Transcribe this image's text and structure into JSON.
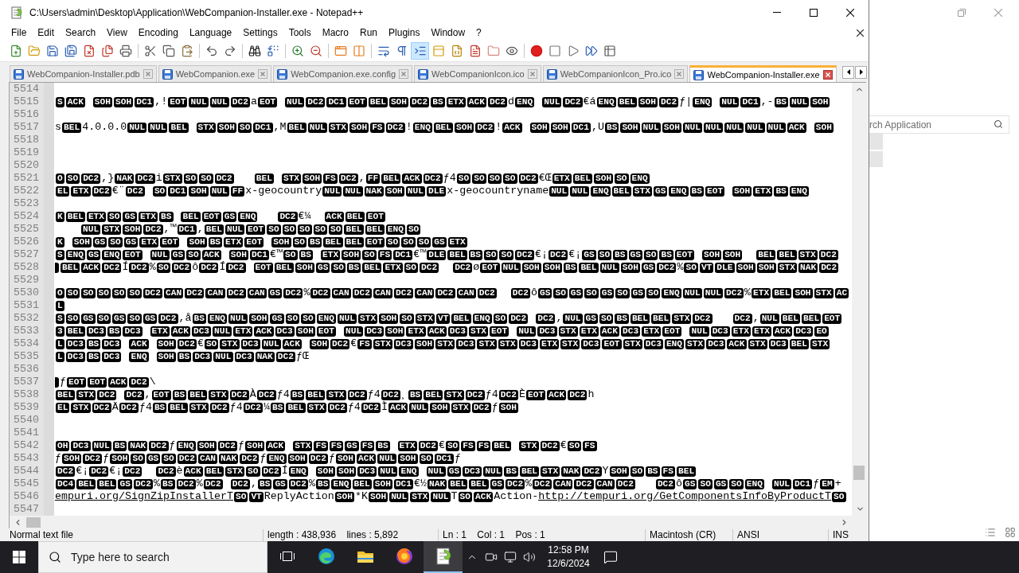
{
  "window": {
    "title": "C:\\Users\\admin\\Desktop\\Application\\WebCompanion-Installer.exe - Notepad++"
  },
  "menu": [
    "File",
    "Edit",
    "Search",
    "View",
    "Encoding",
    "Language",
    "Settings",
    "Tools",
    "Macro",
    "Run",
    "Plugins",
    "Window",
    "?"
  ],
  "toolbar": {
    "groups": [
      [
        {
          "pressed": false
        },
        {
          "pressed": false
        },
        {
          "pressed": false
        },
        {
          "pressed": false
        },
        {
          "pressed": false
        },
        {
          "pressed": false
        },
        {
          "pressed": false
        }
      ],
      [
        {
          "pressed": false
        },
        {
          "pressed": false
        },
        {
          "pressed": false
        }
      ],
      [
        {
          "pressed": false
        },
        {
          "pressed": false
        }
      ],
      [
        {
          "pressed": false
        },
        {
          "pressed": false
        }
      ],
      [
        {
          "pressed": false
        },
        {
          "pressed": false
        }
      ],
      [
        {
          "pressed": false
        },
        {
          "pressed": false
        }
      ],
      [
        {
          "pressed": false
        },
        {
          "pressed": false
        },
        {
          "pressed": true
        },
        {
          "pressed": false
        },
        {
          "pressed": false
        },
        {
          "pressed": false
        },
        {
          "pressed": false
        },
        {
          "pressed": false
        }
      ],
      [
        {
          "pressed": false
        },
        {
          "pressed": false
        },
        {
          "pressed": false
        },
        {
          "pressed": false
        },
        {
          "pressed": false
        }
      ]
    ]
  },
  "tabs": [
    {
      "label": "WebCompanion-Installer.pdb",
      "selected": false
    },
    {
      "label": "WebCompanion.exe",
      "selected": false
    },
    {
      "label": "WebCompanion.exe.config",
      "selected": false
    },
    {
      "label": "WebCompanionIcon.ico",
      "selected": false
    },
    {
      "label": "WebCompanionIcon_Pro.ico",
      "selected": false
    },
    {
      "label": "WebCompanion-Installer.exe",
      "selected": true
    }
  ],
  "editor": {
    "lines": [
      {
        "number": "5514"
      },
      {
        "number": "5515",
        "segments": [
          {
            "kind": "ctrl",
            "codes": [
              "S",
              "ACK"
            ]
          },
          {
            "kind": "gap"
          },
          {
            "kind": "ctrl",
            "codes": [
              "SOH",
              "SOH",
              "DC1"
            ]
          },
          {
            "kind": "text",
            "text": ",!"
          },
          {
            "kind": "ctrl",
            "codes": [
              "EOT",
              "NUL",
              "NUL",
              "DC2"
            ]
          },
          {
            "kind": "text",
            "text": "a"
          },
          {
            "kind": "ctrl",
            "codes": [
              "EOT"
            ]
          },
          {
            "kind": "gap"
          },
          {
            "kind": "ctrl",
            "codes": [
              "NUL",
              "DC2",
              "DC1",
              "EOT",
              "BEL",
              "SOH",
              "DC2",
              "BS",
              "ETX",
              "ACK",
              "DC2"
            ]
          },
          {
            "kind": "text",
            "text": "d"
          },
          {
            "kind": "ctrl",
            "codes": [
              "ENQ"
            ]
          },
          {
            "kind": "gap"
          },
          {
            "kind": "ctrl",
            "codes": [
              "NUL",
              "DC2"
            ]
          },
          {
            "kind": "text",
            "text": "€á"
          },
          {
            "kind": "ctrl",
            "codes": [
              "ENQ",
              "BEL",
              "SOH",
              "DC2"
            ]
          },
          {
            "kind": "text",
            "text": "ƒ|"
          },
          {
            "kind": "ctrl",
            "codes": [
              "ENQ"
            ]
          },
          {
            "kind": "gap"
          },
          {
            "kind": "ctrl",
            "codes": [
              "NUL",
              "DC1"
            ]
          },
          {
            "kind": "text",
            "text": ",-"
          },
          {
            "kind": "ctrl",
            "codes": [
              "BS",
              "NUL",
              "SOH"
            ]
          }
        ]
      },
      {
        "number": "5516"
      },
      {
        "number": "5517",
        "segments": [
          {
            "kind": "text",
            "text": "s"
          },
          {
            "kind": "ctrl",
            "codes": [
              "BEL"
            ]
          },
          {
            "kind": "text",
            "text": "4.0.0.0"
          },
          {
            "kind": "ctrl",
            "codes": [
              "NUL",
              "NUL",
              "BEL"
            ]
          },
          {
            "kind": "gap"
          },
          {
            "kind": "ctrl",
            "codes": [
              "STX",
              "SOH",
              "SO",
              "DC1"
            ]
          },
          {
            "kind": "text",
            "text": ",M"
          },
          {
            "kind": "ctrl",
            "codes": [
              "BEL",
              "NUL",
              "STX",
              "SOH",
              "FS",
              "DC2"
            ]
          },
          {
            "kind": "text",
            "text": "!"
          },
          {
            "kind": "ctrl",
            "codes": [
              "ENQ",
              "BEL",
              "SOH",
              "DC2"
            ]
          },
          {
            "kind": "text",
            "text": "!"
          },
          {
            "kind": "ctrl",
            "codes": [
              "ACK"
            ]
          },
          {
            "kind": "gap"
          },
          {
            "kind": "ctrl",
            "codes": [
              "SOH",
              "SOH",
              "DC1"
            ]
          },
          {
            "kind": "text",
            "text": ",U"
          },
          {
            "kind": "ctrl",
            "codes": [
              "BS",
              "SOH",
              "NUL",
              "SOH",
              "NUL",
              "NUL",
              "NUL",
              "NUL",
              "NUL",
              "ACK"
            ]
          },
          {
            "kind": "gap"
          },
          {
            "kind": "ctrl",
            "codes": [
              "SOH"
            ]
          }
        ]
      },
      {
        "number": "5518"
      },
      {
        "number": "5519"
      },
      {
        "number": "5520"
      },
      {
        "number": "5521",
        "segments": [
          {
            "kind": "ctrl",
            "codes": [
              "O",
              "SO",
              "DC2"
            ]
          },
          {
            "kind": "text",
            "text": ",}"
          },
          {
            "kind": "ctrl",
            "codes": [
              "NAK",
              "DC2"
            ]
          },
          {
            "kind": "text",
            "text": "i"
          },
          {
            "kind": "ctrl",
            "codes": [
              "STX",
              "SO",
              "SO",
              "DC2"
            ]
          },
          {
            "kind": "gap3"
          },
          {
            "kind": "ctrl",
            "codes": [
              "BEL"
            ]
          },
          {
            "kind": "gap"
          },
          {
            "kind": "ctrl",
            "codes": [
              "STX",
              "SOH",
              "FS",
              "DC2"
            ]
          },
          {
            "kind": "text",
            "text": ","
          },
          {
            "kind": "ctrl",
            "codes": [
              "FF",
              "BEL",
              "ACK",
              "DC2"
            ]
          },
          {
            "kind": "text",
            "text": "ƒ4"
          },
          {
            "kind": "ctrl",
            "codes": [
              "SO",
              "SO",
              "SO",
              "SO",
              "DC2"
            ]
          },
          {
            "kind": "text",
            "text": "€Œ"
          },
          {
            "kind": "ctrl",
            "codes": [
              "ETX",
              "BEL",
              "SOH",
              "SO",
              "ENQ"
            ]
          }
        ]
      },
      {
        "number": "5522",
        "segments": [
          {
            "kind": "ctrl",
            "codes": [
              "EL",
              "ETX",
              "DC2"
            ]
          },
          {
            "kind": "text",
            "text": "€¨"
          },
          {
            "kind": "ctrl",
            "codes": [
              "DC2"
            ]
          },
          {
            "kind": "gap"
          },
          {
            "kind": "ctrl",
            "codes": [
              "SO",
              "DC1",
              "SOH",
              "NUL",
              "FF"
            ]
          },
          {
            "kind": "text",
            "text": "x-geocountry"
          },
          {
            "kind": "ctrl",
            "codes": [
              "NUL",
              "NUL",
              "NAK",
              "SOH",
              "NUL",
              "DLE"
            ]
          },
          {
            "kind": "text",
            "text": "x-geocountryname"
          },
          {
            "kind": "ctrl",
            "codes": [
              "NUL",
              "NUL",
              "ENQ",
              "BEL",
              "STX",
              "GS",
              "ENQ",
              "BS",
              "EOT"
            ]
          },
          {
            "kind": "gap"
          },
          {
            "kind": "ctrl",
            "codes": [
              "SOH",
              "ETX",
              "BS",
              "ENQ"
            ]
          }
        ]
      },
      {
        "number": "5523"
      },
      {
        "number": "5524",
        "segments": [
          {
            "kind": "ctrl",
            "codes": [
              "K",
              "BEL",
              "ETX",
              "SO",
              "GS",
              "ETX",
              "BS"
            ]
          },
          {
            "kind": "gap"
          },
          {
            "kind": "ctrl",
            "codes": [
              "BEL",
              "EOT",
              "GS",
              "ENQ"
            ]
          },
          {
            "kind": "gap3"
          },
          {
            "kind": "ctrl",
            "codes": [
              "DC2"
            ]
          },
          {
            "kind": "text",
            "text": "€¼"
          },
          {
            "kind": "gap2"
          },
          {
            "kind": "ctrl",
            "codes": [
              "ACK",
              "BEL",
              "EOT"
            ]
          }
        ]
      },
      {
        "number": "5525",
        "segments": [
          {
            "kind": "gap4"
          },
          {
            "kind": "ctrl",
            "codes": [
              "NUL",
              "STX",
              "SOH",
              "DC2"
            ]
          },
          {
            "kind": "text",
            "text": ",™"
          },
          {
            "kind": "ctrl",
            "codes": [
              "DC1"
            ]
          },
          {
            "kind": "text",
            "text": ","
          },
          {
            "kind": "ctrl",
            "codes": [
              "BEL",
              "NUL",
              "EOT",
              "SO",
              "SO",
              "SO",
              "SO",
              "SO",
              "BEL",
              "BEL",
              "ENQ",
              "SO"
            ]
          }
        ]
      },
      {
        "number": "5526",
        "segments": [
          {
            "kind": "ctrl",
            "codes": [
              "K"
            ]
          },
          {
            "kind": "gap"
          },
          {
            "kind": "ctrl",
            "codes": [
              "SOH",
              "GS",
              "SO",
              "GS",
              "ETX",
              "EOT"
            ]
          },
          {
            "kind": "gap"
          },
          {
            "kind": "ctrl",
            "codes": [
              "SOH",
              "BS",
              "ETX",
              "EOT"
            ]
          },
          {
            "kind": "gap"
          },
          {
            "kind": "ctrl",
            "codes": [
              "SOH",
              "SO",
              "BS",
              "BEL",
              "BEL",
              "EOT",
              "SO",
              "SO",
              "SO",
              "GS",
              "ETX"
            ]
          }
        ]
      },
      {
        "number": "5527",
        "segments": [
          {
            "kind": "ctrl",
            "codes": [
              "S",
              "ENQ",
              "GS",
              "ENQ",
              "EOT"
            ]
          },
          {
            "kind": "gap"
          },
          {
            "kind": "ctrl",
            "codes": [
              "NUL",
              "GS",
              "SO",
              "ACK"
            ]
          },
          {
            "kind": "gap"
          },
          {
            "kind": "ctrl",
            "codes": [
              "SOH",
              "DC1"
            ]
          },
          {
            "kind": "text",
            "text": "€™"
          },
          {
            "kind": "ctrl",
            "codes": [
              "SO",
              "BS"
            ]
          },
          {
            "kind": "gap"
          },
          {
            "kind": "ctrl",
            "codes": [
              "ETX",
              "SOH",
              "SO",
              "FS",
              "DC1"
            ]
          },
          {
            "kind": "text",
            "text": "€™"
          },
          {
            "kind": "ctrl",
            "codes": [
              "DLE",
              "BEL",
              "BS",
              "SO",
              "SO",
              "DC2"
            ]
          },
          {
            "kind": "text",
            "text": "€¡"
          },
          {
            "kind": "ctrl",
            "codes": [
              "DC2"
            ]
          },
          {
            "kind": "text",
            "text": "€¡"
          },
          {
            "kind": "ctrl",
            "codes": [
              "GS",
              "SO",
              "BS",
              "GS",
              "SO",
              "BS",
              "EOT"
            ]
          },
          {
            "kind": "gap"
          },
          {
            "kind": "ctrl",
            "codes": [
              "SOH",
              "SOH"
            ]
          },
          {
            "kind": "gap2"
          },
          {
            "kind": "ctrl",
            "codes": [
              "BEL",
              "BEL",
              "STX",
              "DC2"
            ]
          }
        ]
      },
      {
        "number": "5528",
        "segments": [
          {
            "kind": "clipped"
          },
          {
            "kind": "ctrl",
            "codes": [
              "BEL",
              "ACK",
              "DC2"
            ]
          },
          {
            "kind": "text",
            "text": "Í"
          },
          {
            "kind": "ctrl",
            "codes": [
              "DC2"
            ]
          },
          {
            "kind": "text",
            "text": "%"
          },
          {
            "kind": "ctrl",
            "codes": [
              "SO",
              "DC2"
            ]
          },
          {
            "kind": "text",
            "text": "ô"
          },
          {
            "kind": "ctrl",
            "codes": [
              "DC2"
            ]
          },
          {
            "kind": "text",
            "text": "Í"
          },
          {
            "kind": "ctrl",
            "codes": [
              "DC2"
            ]
          },
          {
            "kind": "gap"
          },
          {
            "kind": "ctrl",
            "codes": [
              "EOT",
              "BEL",
              "SOH",
              "GS",
              "SO",
              "BS",
              "BEL",
              "ETX",
              "SO",
              "DC2"
            ]
          },
          {
            "kind": "gap2"
          },
          {
            "kind": "ctrl",
            "codes": [
              "DC2"
            ]
          },
          {
            "kind": "text",
            "text": "ø"
          },
          {
            "kind": "ctrl",
            "codes": [
              "EOT",
              "NUL",
              "SOH",
              "SOH",
              "BS",
              "BEL",
              "NUL",
              "SOH",
              "GS",
              "DC2"
            ]
          },
          {
            "kind": "text",
            "text": "%"
          },
          {
            "kind": "ctrl",
            "codes": [
              "SO",
              "VT",
              "DLE",
              "SOH",
              "SOH",
              "STX",
              "NAK",
              "DC2"
            ]
          }
        ]
      },
      {
        "number": "5529"
      },
      {
        "number": "5530",
        "segments": [
          {
            "kind": "ctrl",
            "codes": [
              "O",
              "SO",
              "SO",
              "SO",
              "SO",
              "SO",
              "DC2",
              "CAN",
              "DC2",
              "CAN",
              "DC2",
              "CAN",
              "GS",
              "DC2"
            ]
          },
          {
            "kind": "text",
            "text": "%"
          },
          {
            "kind": "ctrl",
            "codes": [
              "DC2",
              "CAN",
              "DC2",
              "CAN",
              "DC2",
              "CAN",
              "DC2",
              "CAN",
              "DC2"
            ]
          },
          {
            "kind": "gap2"
          },
          {
            "kind": "ctrl",
            "codes": [
              "DC2"
            ]
          },
          {
            "kind": "text",
            "text": "ô"
          },
          {
            "kind": "ctrl",
            "codes": [
              "GS",
              "SO",
              "GS",
              "SO",
              "GS",
              "SO",
              "GS",
              "SO",
              "ENQ",
              "NUL",
              "NUL",
              "DC2"
            ]
          },
          {
            "kind": "text",
            "text": "%"
          },
          {
            "kind": "ctrl",
            "codes": [
              "ETX",
              "BEL",
              "SOH",
              "STX",
              "AC"
            ]
          }
        ]
      },
      {
        "number": "5531",
        "segments": [
          {
            "kind": "ctrl",
            "codes": [
              "L"
            ]
          }
        ]
      },
      {
        "number": "5532",
        "segments": [
          {
            "kind": "ctrl",
            "codes": [
              "S",
              "SO",
              "GS",
              "SO",
              "GS",
              "SO",
              "GS",
              "DC2"
            ]
          },
          {
            "kind": "text",
            "text": ",å"
          },
          {
            "kind": "ctrl",
            "codes": [
              "BS",
              "ENQ",
              "NUL",
              "SOH",
              "GS",
              "SO",
              "SO",
              "ENQ",
              "NUL",
              "STX",
              "SOH",
              "SO",
              "STX",
              "VT",
              "BEL",
              "ENQ",
              "SO",
              "DC2"
            ]
          },
          {
            "kind": "gap"
          },
          {
            "kind": "ctrl",
            "codes": [
              "DC2"
            ]
          },
          {
            "kind": "text",
            "text": ","
          },
          {
            "kind": "ctrl",
            "codes": [
              "NUL",
              "GS",
              "SO",
              "BS",
              "BEL",
              "BEL",
              "STX",
              "DC2"
            ]
          },
          {
            "kind": "gap3"
          },
          {
            "kind": "ctrl",
            "codes": [
              "DC2"
            ]
          },
          {
            "kind": "text",
            "text": ","
          },
          {
            "kind": "ctrl",
            "codes": [
              "NUL",
              "BEL",
              "BEL",
              "EOT"
            ]
          }
        ]
      },
      {
        "number": "5533",
        "segments": [
          {
            "kind": "ctrl",
            "codes": [
              "3",
              "BEL",
              "DC3",
              "BS",
              "DC3"
            ]
          },
          {
            "kind": "gap"
          },
          {
            "kind": "ctrl",
            "codes": [
              "ETX",
              "ACK",
              "DC3",
              "NUL",
              "ETX",
              "ACK",
              "DC3",
              "SOH",
              "EOT"
            ]
          },
          {
            "kind": "gap"
          },
          {
            "kind": "ctrl",
            "codes": [
              "NUL",
              "DC3",
              "SOH",
              "ETX",
              "ACK",
              "DC3",
              "STX",
              "EOT"
            ]
          },
          {
            "kind": "gap"
          },
          {
            "kind": "ctrl",
            "codes": [
              "NUL",
              "DC3",
              "STX",
              "ETX",
              "ACK",
              "DC3",
              "ETX",
              "EOT"
            ]
          },
          {
            "kind": "gap"
          },
          {
            "kind": "ctrl",
            "codes": [
              "NUL",
              "DC3",
              "ETX",
              "ETX",
              "ACK",
              "DC3",
              "EO"
            ]
          }
        ]
      },
      {
        "number": "5534",
        "segments": [
          {
            "kind": "ctrl",
            "codes": [
              "L",
              "DC3",
              "BS",
              "DC3"
            ]
          },
          {
            "kind": "gap"
          },
          {
            "kind": "ctrl",
            "codes": [
              "ACK"
            ]
          },
          {
            "kind": "gap"
          },
          {
            "kind": "ctrl",
            "codes": [
              "SOH",
              "DC2"
            ]
          },
          {
            "kind": "text",
            "text": "€"
          },
          {
            "kind": "ctrl",
            "codes": [
              "SO",
              "STX",
              "DC3",
              "NUL",
              "ACK"
            ]
          },
          {
            "kind": "gap"
          },
          {
            "kind": "ctrl",
            "codes": [
              "SOH",
              "DC2"
            ]
          },
          {
            "kind": "text",
            "text": "€"
          },
          {
            "kind": "ctrl",
            "codes": [
              "FS",
              "STX",
              "DC3",
              "SOH",
              "STX",
              "DC3",
              "STX",
              "STX",
              "DC3",
              "ETX",
              "STX",
              "DC3",
              "EOT",
              "STX",
              "DC3",
              "ENQ",
              "STX",
              "DC3",
              "ACK",
              "STX",
              "DC3",
              "BEL",
              "STX"
            ]
          }
        ]
      },
      {
        "number": "5535",
        "segments": [
          {
            "kind": "ctrl",
            "codes": [
              "L",
              "DC3",
              "BS",
              "DC3"
            ]
          },
          {
            "kind": "gap"
          },
          {
            "kind": "ctrl",
            "codes": [
              "ENQ"
            ]
          },
          {
            "kind": "gap"
          },
          {
            "kind": "ctrl",
            "codes": [
              "SOH",
              "BS",
              "DC3",
              "NUL",
              "DC3",
              "NAK",
              "DC2"
            ]
          },
          {
            "kind": "text",
            "text": "ƒŒ"
          }
        ]
      },
      {
        "number": "5536"
      },
      {
        "number": "5537",
        "segments": [
          {
            "kind": "clipped"
          },
          {
            "kind": "text",
            "text": "ƒ"
          },
          {
            "kind": "ctrl",
            "codes": [
              "EOT",
              "EOT",
              "ACK",
              "DC2"
            ]
          },
          {
            "kind": "text",
            "text": "\\"
          }
        ]
      },
      {
        "number": "5538",
        "segments": [
          {
            "kind": "ctrl",
            "codes": [
              "BEL",
              "STX",
              "DC2"
            ]
          },
          {
            "kind": "gap"
          },
          {
            "kind": "ctrl",
            "codes": [
              "DC2"
            ]
          },
          {
            "kind": "text",
            "text": ","
          },
          {
            "kind": "ctrl",
            "codes": [
              "EOT",
              "BS",
              "BEL",
              "STX",
              "DC2"
            ]
          },
          {
            "kind": "text",
            "text": "À"
          },
          {
            "kind": "ctrl",
            "codes": [
              "DC2"
            ]
          },
          {
            "kind": "text",
            "text": "ƒ4"
          },
          {
            "kind": "ctrl",
            "codes": [
              "BS",
              "BEL",
              "STX",
              "DC2"
            ]
          },
          {
            "kind": "text",
            "text": "ƒ4"
          },
          {
            "kind": "ctrl",
            "codes": [
              "DC2"
            ]
          },
          {
            "kind": "text",
            "text": "¸"
          },
          {
            "kind": "ctrl",
            "codes": [
              "BS",
              "BEL",
              "STX",
              "DC2"
            ]
          },
          {
            "kind": "text",
            "text": "ƒ4"
          },
          {
            "kind": "ctrl",
            "codes": [
              "DC2"
            ]
          },
          {
            "kind": "text",
            "text": "È"
          },
          {
            "kind": "ctrl",
            "codes": [
              "EOT",
              "ACK",
              "DC2"
            ]
          },
          {
            "kind": "text",
            "text": "h"
          }
        ]
      },
      {
        "number": "5539",
        "segments": [
          {
            "kind": "ctrl",
            "codes": [
              "EL",
              "STX",
              "DC2"
            ]
          },
          {
            "kind": "text",
            "text": "Ä"
          },
          {
            "kind": "ctrl",
            "codes": [
              "DC2"
            ]
          },
          {
            "kind": "text",
            "text": "ƒ4"
          },
          {
            "kind": "ctrl",
            "codes": [
              "BS",
              "BEL",
              "STX",
              "DC2"
            ]
          },
          {
            "kind": "text",
            "text": "ƒ4"
          },
          {
            "kind": "ctrl",
            "codes": [
              "DC2"
            ]
          },
          {
            "kind": "text",
            "text": "¼"
          },
          {
            "kind": "ctrl",
            "codes": [
              "BS",
              "BEL",
              "STX",
              "DC2"
            ]
          },
          {
            "kind": "text",
            "text": "ƒ4"
          },
          {
            "kind": "ctrl",
            "codes": [
              "DC2"
            ]
          },
          {
            "kind": "text",
            "text": "Ì"
          },
          {
            "kind": "ctrl",
            "codes": [
              "ACK",
              "NUL",
              "SOH",
              "STX",
              "DC2"
            ]
          },
          {
            "kind": "text",
            "text": "ƒ"
          },
          {
            "kind": "ctrl",
            "codes": [
              "SOH"
            ]
          }
        ]
      },
      {
        "number": "5540"
      },
      {
        "number": "5541"
      },
      {
        "number": "5542",
        "segments": [
          {
            "kind": "ctrl",
            "codes": [
              "OH",
              "DC3",
              "NUL",
              "BS",
              "NAK",
              "DC2"
            ]
          },
          {
            "kind": "text",
            "text": "ƒ"
          },
          {
            "kind": "ctrl",
            "codes": [
              "ENQ",
              "SOH",
              "DC2"
            ]
          },
          {
            "kind": "text",
            "text": "ƒ"
          },
          {
            "kind": "ctrl",
            "codes": [
              "SOH",
              "ACK"
            ]
          },
          {
            "kind": "gap"
          },
          {
            "kind": "ctrl",
            "codes": [
              "STX",
              "FS",
              "FS",
              "GS",
              "FS",
              "BS"
            ]
          },
          {
            "kind": "gap"
          },
          {
            "kind": "ctrl",
            "codes": [
              "ETX",
              "DC2"
            ]
          },
          {
            "kind": "text",
            "text": "€"
          },
          {
            "kind": "ctrl",
            "codes": [
              "SO",
              "FS",
              "FS",
              "BEL"
            ]
          },
          {
            "kind": "gap"
          },
          {
            "kind": "ctrl",
            "codes": [
              "STX",
              "DC2"
            ]
          },
          {
            "kind": "text",
            "text": "€"
          },
          {
            "kind": "ctrl",
            "codes": [
              "SO",
              "FS"
            ]
          }
        ]
      },
      {
        "number": "5543",
        "segments": [
          {
            "kind": "text",
            "text": "ƒ"
          },
          {
            "kind": "ctrl",
            "codes": [
              "SOH",
              "DC2"
            ]
          },
          {
            "kind": "text",
            "text": "ƒ"
          },
          {
            "kind": "ctrl",
            "codes": [
              "SOH",
              "SO",
              "GS",
              "SO",
              "DC2",
              "CAN",
              "NAK",
              "DC2"
            ]
          },
          {
            "kind": "text",
            "text": "ƒ"
          },
          {
            "kind": "ctrl",
            "codes": [
              "ENQ",
              "SOH",
              "DC2"
            ]
          },
          {
            "kind": "text",
            "text": "ƒ"
          },
          {
            "kind": "ctrl",
            "codes": [
              "SOH",
              "ACK",
              "NUL",
              "SOH",
              "SO",
              "DC1"
            ]
          },
          {
            "kind": "text",
            "text": "ƒ"
          }
        ]
      },
      {
        "number": "5544",
        "segments": [
          {
            "kind": "ctrl",
            "codes": [
              "DC2"
            ]
          },
          {
            "kind": "text",
            "text": "€¡"
          },
          {
            "kind": "ctrl",
            "codes": [
              "DC2"
            ]
          },
          {
            "kind": "text",
            "text": "€¡"
          },
          {
            "kind": "ctrl",
            "codes": [
              "DC2"
            ]
          },
          {
            "kind": "gap2"
          },
          {
            "kind": "ctrl",
            "codes": [
              "DC2"
            ]
          },
          {
            "kind": "text",
            "text": "è"
          },
          {
            "kind": "ctrl",
            "codes": [
              "ACK",
              "BEL",
              "STX",
              "SO",
              "DC2"
            ]
          },
          {
            "kind": "text",
            "text": "Í"
          },
          {
            "kind": "ctrl",
            "codes": [
              "ENQ"
            ]
          },
          {
            "kind": "gap"
          },
          {
            "kind": "ctrl",
            "codes": [
              "SOH",
              "SOH",
              "DC3",
              "NUL",
              "ENQ"
            ]
          },
          {
            "kind": "gap"
          },
          {
            "kind": "ctrl",
            "codes": [
              "NUL",
              "GS",
              "DC3",
              "NUL",
              "BS",
              "BEL",
              "STX",
              "NAK",
              "DC2"
            ]
          },
          {
            "kind": "text",
            "text": "Y"
          },
          {
            "kind": "ctrl",
            "codes": [
              "SOH",
              "SO",
              "BS",
              "FS",
              "BEL"
            ]
          }
        ]
      },
      {
        "number": "5545",
        "segments": [
          {
            "kind": "ctrl",
            "codes": [
              "DC4",
              "BEL",
              "BEL",
              "GS",
              "DC2"
            ]
          },
          {
            "kind": "text",
            "text": "%"
          },
          {
            "kind": "ctrl",
            "codes": [
              "BS",
              "DC2"
            ]
          },
          {
            "kind": "text",
            "text": "%"
          },
          {
            "kind": "ctrl",
            "codes": [
              "DC2"
            ]
          },
          {
            "kind": "gap"
          },
          {
            "kind": "ctrl",
            "codes": [
              "DC2"
            ]
          },
          {
            "kind": "text",
            "text": ","
          },
          {
            "kind": "ctrl",
            "codes": [
              "BS",
              "GS",
              "DC2"
            ]
          },
          {
            "kind": "text",
            "text": "%"
          },
          {
            "kind": "ctrl",
            "codes": [
              "BS",
              "ENQ",
              "BEL",
              "SOH",
              "DC1"
            ]
          },
          {
            "kind": "text",
            "text": "€½"
          },
          {
            "kind": "ctrl",
            "codes": [
              "NAK",
              "BEL",
              "BEL",
              "GS",
              "DC2"
            ]
          },
          {
            "kind": "text",
            "text": "%"
          },
          {
            "kind": "ctrl",
            "codes": [
              "DC2",
              "CAN",
              "DC2",
              "CAN",
              "DC2"
            ]
          },
          {
            "kind": "gap3"
          },
          {
            "kind": "ctrl",
            "codes": [
              "DC2"
            ]
          },
          {
            "kind": "text",
            "text": "ô"
          },
          {
            "kind": "ctrl",
            "codes": [
              "GS",
              "SO",
              "GS",
              "SO",
              "ENQ"
            ]
          },
          {
            "kind": "gap"
          },
          {
            "kind": "ctrl",
            "codes": [
              "NUL",
              "DC1"
            ]
          },
          {
            "kind": "text",
            "text": "ƒ"
          },
          {
            "kind": "ctrl",
            "codes": [
              "EM"
            ]
          },
          {
            "kind": "text",
            "text": "+"
          }
        ]
      },
      {
        "number": "5546",
        "segments": [
          {
            "kind": "link",
            "text": "empuri.org/SignZipInstallerT"
          },
          {
            "kind": "ctrl",
            "codes": [
              "SO",
              "VT"
            ]
          },
          {
            "kind": "text",
            "text": "ReplyAction"
          },
          {
            "kind": "ctrl",
            "codes": [
              "SOH"
            ]
          },
          {
            "kind": "text",
            "text": "*K"
          },
          {
            "kind": "ctrl",
            "codes": [
              "SOH",
              "NUL",
              "STX",
              "NUL"
            ]
          },
          {
            "kind": "text",
            "text": "T"
          },
          {
            "kind": "ctrl",
            "codes": [
              "SO",
              "ACK"
            ]
          },
          {
            "kind": "text",
            "text": "Action-"
          },
          {
            "kind": "link",
            "text": "http://tempuri.org/GetComponentsInfoByProductT"
          },
          {
            "kind": "ctrl",
            "codes": [
              "SO"
            ]
          }
        ]
      },
      {
        "number": "5547"
      }
    ]
  },
  "status_bar": {
    "file_type": "Normal text file",
    "length_lines": "length : 438,936    lines : 5,892",
    "position": "Ln : 1    Col : 1    Pos : 1",
    "eol": "Macintosh (CR)",
    "encoding": "ANSI",
    "mode": "INS"
  },
  "background_window": {
    "search": {
      "placeholder": "rch Application"
    }
  },
  "taskbar": {
    "search": {
      "placeholder": "Type here to search"
    },
    "apps": [
      {
        "selected": false
      },
      {
        "selected": false
      },
      {
        "selected": false
      },
      {
        "selected": true
      }
    ],
    "clock": {
      "time": "12:58 PM",
      "date": "12/6/2024"
    }
  }
}
